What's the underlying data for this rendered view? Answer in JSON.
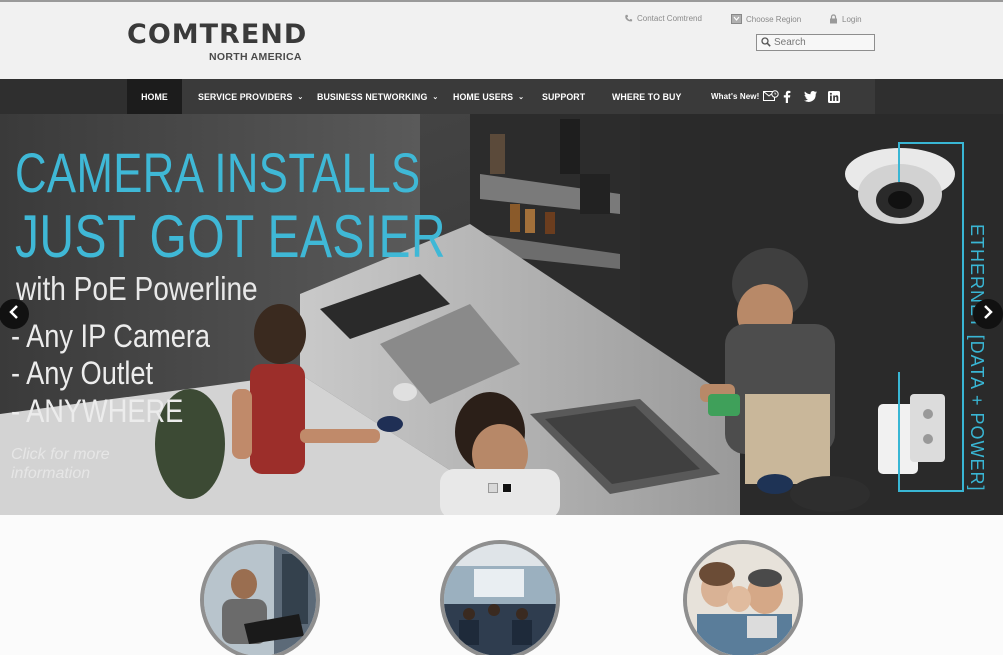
{
  "brand": {
    "name": "COMTREND",
    "subtitle": "NORTH AMERICA"
  },
  "utility": {
    "contact": "Contact Comtrend",
    "region": "Choose Region",
    "login": "Login",
    "search_placeholder": "Search",
    "contact_icon": "phone-icon",
    "region_icon": "region-icon",
    "login_icon": "lock-icon"
  },
  "nav": {
    "items": [
      {
        "label": "HOME",
        "active": true
      },
      {
        "label": "SERVICE PROVIDERS",
        "dropdown": true
      },
      {
        "label": "BUSINESS NETWORKING",
        "dropdown": true
      },
      {
        "label": "HOME USERS",
        "dropdown": true
      },
      {
        "label": "SUPPORT"
      },
      {
        "label": "WHERE TO BUY"
      }
    ],
    "whats_new": "What's New!",
    "social": [
      "facebook-icon",
      "twitter-icon",
      "linkedin-icon"
    ]
  },
  "hero": {
    "headline_1": "CAMERA INSTALLS",
    "headline_2": "JUST GOT EASIER",
    "subhead": "with PoE Powerline",
    "bullets": [
      "- Any IP Camera",
      "- Any Outlet",
      "- ANYWHERE"
    ],
    "cta": "Click for more information",
    "side_label": "ETHERNET [DATA + POWER]",
    "slide_count": 2,
    "active_slide": 2
  },
  "colors": {
    "accent": "#3fb8d6",
    "nav_bg": "#3a3a3a",
    "nav_active": "#1c1c1c",
    "header_bg": "#f1f1f1"
  },
  "features": {
    "images": [
      "service-providers-photo",
      "business-networking-photo",
      "home-users-photo"
    ]
  }
}
